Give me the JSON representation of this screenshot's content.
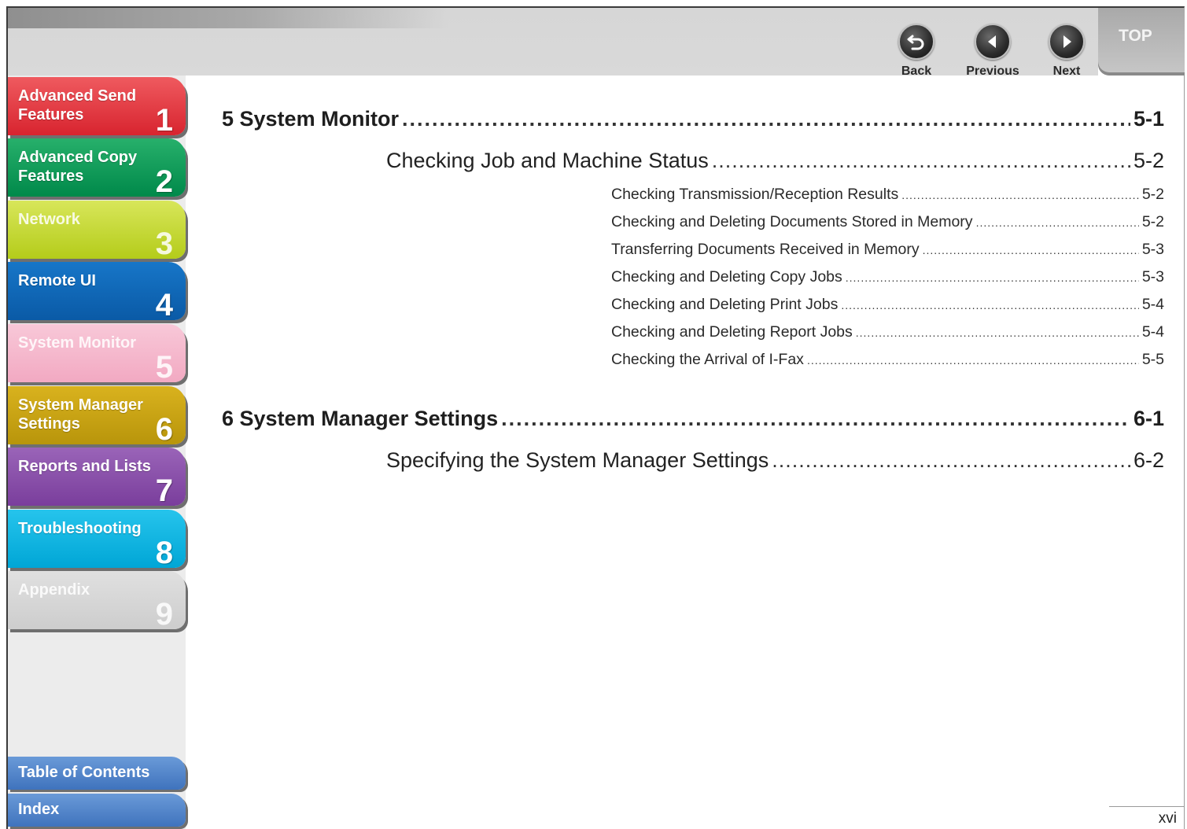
{
  "nav": {
    "back": "Back",
    "previous": "Previous",
    "next": "Next",
    "top": "TOP"
  },
  "sidebar": {
    "tabs": [
      {
        "label": "Advanced Send Features",
        "num": "1"
      },
      {
        "label": "Advanced Copy Features",
        "num": "2"
      },
      {
        "label": "Network",
        "num": "3"
      },
      {
        "label": "Remote UI",
        "num": "4"
      },
      {
        "label": "System Monitor",
        "num": "5"
      },
      {
        "label": "System Manager Settings",
        "num": "6"
      },
      {
        "label": "Reports and Lists",
        "num": "7"
      },
      {
        "label": "Troubleshooting",
        "num": "8"
      },
      {
        "label": "Appendix",
        "num": "9"
      }
    ],
    "toc": "Table of Contents",
    "index": "Index"
  },
  "toc": {
    "ch5": {
      "title": "5 System Monitor",
      "page": "5-1"
    },
    "ch5_sec1": {
      "title": "Checking Job and Machine Status",
      "page": "5-2"
    },
    "ch5_items": [
      {
        "title": "Checking Transmission/Reception Results",
        "page": "5-2"
      },
      {
        "title": "Checking and Deleting Documents Stored in Memory",
        "page": "5-2"
      },
      {
        "title": "Transferring Documents Received in Memory",
        "page": "5-3"
      },
      {
        "title": "Checking and Deleting Copy Jobs",
        "page": "5-3"
      },
      {
        "title": "Checking and Deleting Print Jobs",
        "page": "5-4"
      },
      {
        "title": "Checking and Deleting Report Jobs",
        "page": "5-4"
      },
      {
        "title": "Checking the Arrival of I-Fax",
        "page": "5-5"
      }
    ],
    "ch6": {
      "title": "6 System Manager Settings",
      "page": "6-1"
    },
    "ch6_sec1": {
      "title": "Specifying the System Manager Settings",
      "page": "6-2"
    }
  },
  "footer": {
    "page_number": "xvi"
  }
}
